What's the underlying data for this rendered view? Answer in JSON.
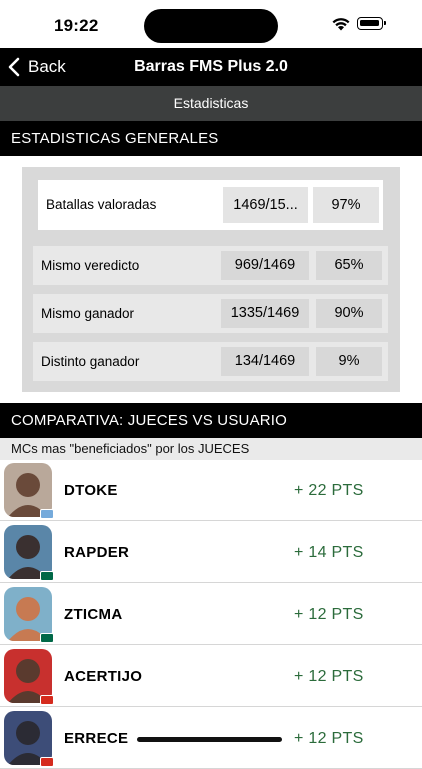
{
  "status_bar": {
    "time": "19:22"
  },
  "nav": {
    "back_label": "Back",
    "title": "Barras FMS Plus 2.0"
  },
  "subtab": {
    "label": "Estadisticas"
  },
  "general": {
    "title": "ESTADISTICAS GENERALES",
    "rows": [
      {
        "label": "Batallas valoradas",
        "fraction": "1469/15...",
        "percent": "97%"
      },
      {
        "label": "Mismo veredicto",
        "fraction": "969/1469",
        "percent": "65%"
      },
      {
        "label": "Mismo ganador",
        "fraction": "1335/1469",
        "percent": "90%"
      },
      {
        "label": "Distinto ganador",
        "fraction": "134/1469",
        "percent": "9%"
      }
    ]
  },
  "comparativa": {
    "title": "COMPARATIVA: JUECES VS USUARIO",
    "caption": "MCs mas \"beneficiados\" por los JUECES",
    "mcs": [
      {
        "name": "DTOKE",
        "points": "+ 22 PTS",
        "avatar_color": "#6a4a3a",
        "bg_color": "#b9a89a",
        "flag_color": "#75aadb"
      },
      {
        "name": "RAPDER",
        "points": "+ 14 PTS",
        "avatar_color": "#3a3030",
        "bg_color": "#5a86a8",
        "flag_color": "#006847"
      },
      {
        "name": "ZTICMA",
        "points": "+ 12 PTS",
        "avatar_color": "#c77a52",
        "bg_color": "#7fb0c9",
        "flag_color": "#006847"
      },
      {
        "name": "ACERTIJO",
        "points": "+ 12 PTS",
        "avatar_color": "#5a3a2e",
        "bg_color": "#c8302e",
        "flag_color": "#d52b1e"
      },
      {
        "name": "ERRECE",
        "points": "+ 12 PTS",
        "avatar_color": "#2b2b34",
        "bg_color": "#3d4d78",
        "flag_color": "#d52b1e"
      }
    ]
  }
}
